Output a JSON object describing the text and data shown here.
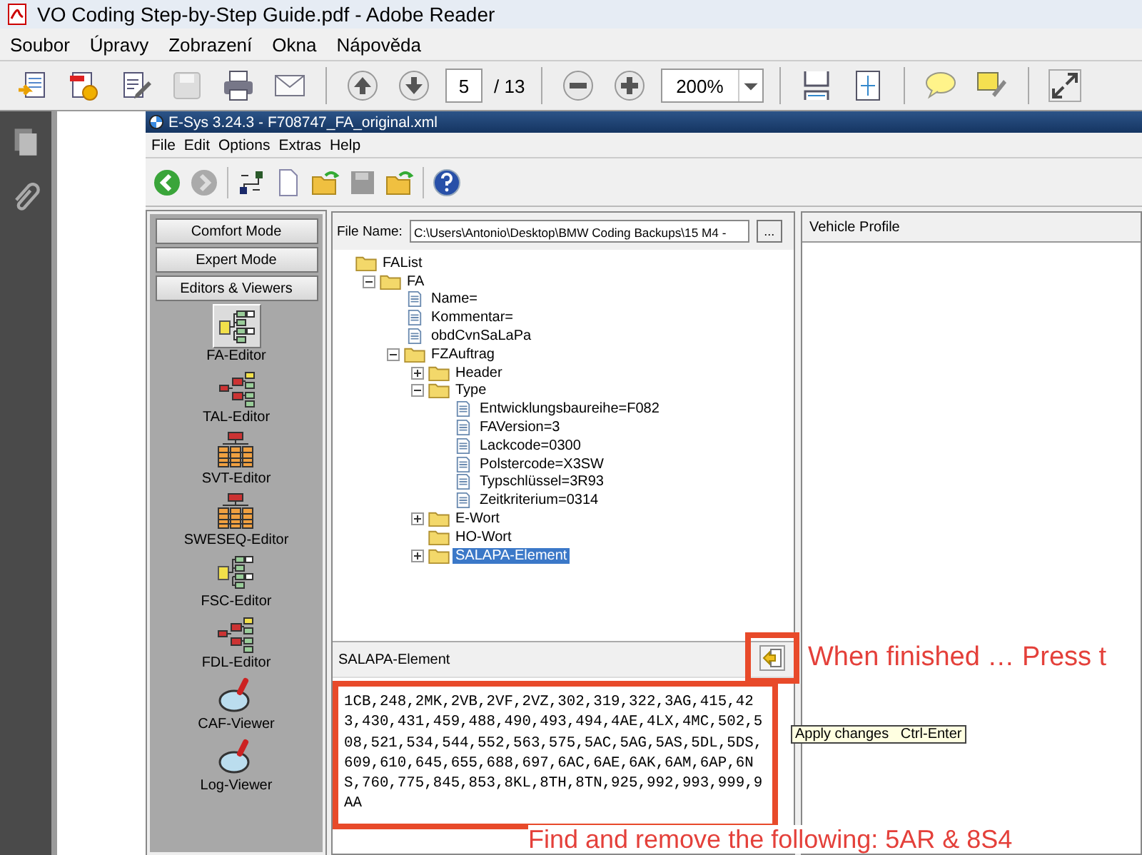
{
  "window": {
    "title": "VO Coding Step-by-Step Guide.pdf - Adobe Reader"
  },
  "menu": [
    "Soubor",
    "Úpravy",
    "Zobrazení",
    "Okna",
    "Nápověda"
  ],
  "toolbar": {
    "page": "5",
    "page_count": "/ 13",
    "zoom": "200%"
  },
  "esys": {
    "title": "E-Sys 3.24.3 - F708747_FA_original.xml",
    "menu": [
      "File",
      "Edit",
      "Options",
      "Extras",
      "Help"
    ],
    "mode_buttons": [
      "Comfort Mode",
      "Expert Mode",
      "Editors & Viewers"
    ],
    "editors": [
      {
        "label": "FA-Editor",
        "kind": "hierarchy",
        "selected": true
      },
      {
        "label": "TAL-Editor",
        "kind": "branch",
        "selected": false
      },
      {
        "label": "SVT-Editor",
        "kind": "table",
        "selected": false
      },
      {
        "label": "SWESEQ-Editor",
        "kind": "table",
        "selected": false
      },
      {
        "label": "FSC-Editor",
        "kind": "hierarchy",
        "selected": false
      },
      {
        "label": "FDL-Editor",
        "kind": "branch",
        "selected": false
      },
      {
        "label": "CAF-Viewer",
        "kind": "viewer",
        "selected": false
      },
      {
        "label": "Log-Viewer",
        "kind": "viewer",
        "selected": false
      }
    ],
    "file_name": {
      "label": "File Name:",
      "value": "C:\\Users\\Antonio\\Desktop\\BMW Coding Backups\\15 M4 -",
      "browse": "..."
    },
    "tree": [
      {
        "label": "FAList",
        "kind": "folder",
        "selected": false,
        "children": [
          {
            "label": "FA",
            "kind": "folder",
            "expanded": true,
            "selected": false,
            "children": [
              {
                "label": "Name=",
                "kind": "document",
                "selected": false
              },
              {
                "label": "Kommentar=",
                "kind": "document",
                "selected": false
              },
              {
                "label": "obdCvnSaLaPa",
                "kind": "document",
                "selected": false
              },
              {
                "label": "FZAuftrag",
                "kind": "folder",
                "expanded": true,
                "selected": false,
                "children": [
                  {
                    "label": "Header",
                    "kind": "folder",
                    "expanded": false,
                    "selected": false
                  },
                  {
                    "label": "Type",
                    "kind": "folder",
                    "expanded": true,
                    "selected": false,
                    "children": [
                      {
                        "label": "Entwicklungsbaureihe=F082",
                        "kind": "document",
                        "selected": false
                      },
                      {
                        "label": "FAVersion=3",
                        "kind": "document",
                        "selected": false
                      },
                      {
                        "label": "Lackcode=0300",
                        "kind": "document",
                        "selected": false
                      },
                      {
                        "label": "Polstercode=X3SW",
                        "kind": "document",
                        "selected": false
                      },
                      {
                        "label": "Typschlüssel=3R93",
                        "kind": "document",
                        "selected": false
                      },
                      {
                        "label": "Zeitkriterium=0314",
                        "kind": "document",
                        "selected": false
                      }
                    ]
                  },
                  {
                    "label": "E-Wort",
                    "kind": "folder",
                    "expanded": false,
                    "selected": false
                  },
                  {
                    "label": "HO-Wort",
                    "kind": "folder",
                    "selected": false
                  },
                  {
                    "label": "SALAPA-Element",
                    "kind": "folder",
                    "expanded": false,
                    "selected": true
                  }
                ]
              }
            ]
          }
        ]
      }
    ],
    "detail": {
      "title": "SALAPA-Element",
      "value": "1CB,248,2MK,2VB,2VF,2VZ,302,319,322,3AG,415,423,430,431,459,488,490,493,494,4AE,4LX,4MC,502,508,521,534,544,552,563,575,5AC,5AG,5AS,5DL,5DS,609,610,645,655,688,697,6AC,6AE,6AK,6AM,6AP,6NS,760,775,845,853,8KL,8TH,8TN,925,992,993,999,9AA"
    },
    "tooltip": {
      "label": "Apply changes",
      "shortcut": "Ctrl-Enter"
    },
    "vehicle_profile": {
      "title": "Vehicle Profile"
    }
  },
  "annotations": [
    "When finished … Press t",
    "Find and remove the following: 5AR & 8S4"
  ]
}
